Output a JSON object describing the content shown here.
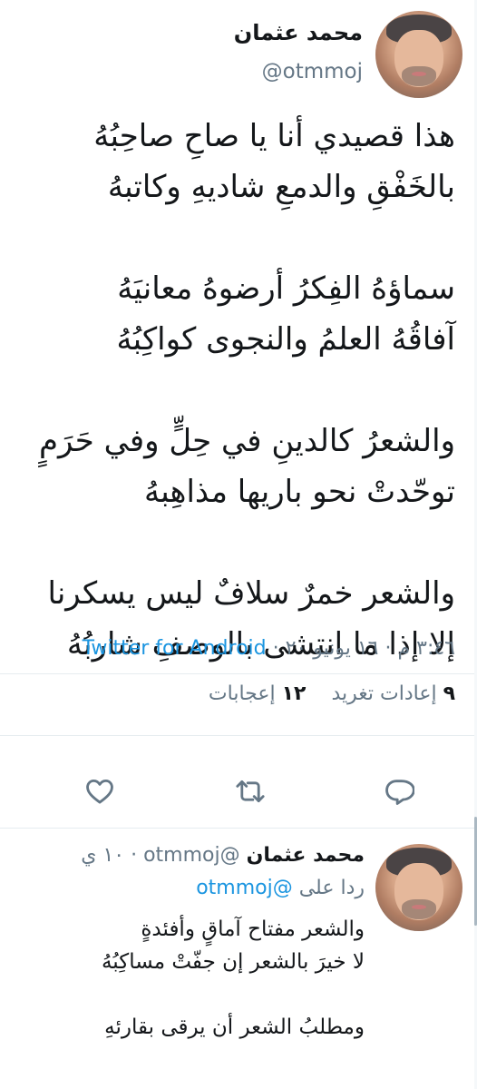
{
  "tweet": {
    "display_name": "محمد عثمان",
    "handle": "@otmmoj",
    "poem_lines": [
      "هذا قصيدي أنا يا صاحِ صاحِبُهُ",
      "بالخَفْقِ والدمعِ شاديهِ وكاتبهُ",
      "",
      "سماؤهُ الفِكرُ أرضوهُ معانيَهُ",
      "آفاقُهُ العلمُ والنجوى كواكِبُهُ",
      "",
      "والشعرُ كالدينِ في حِلٍّ وفي حَرَمٍ",
      "توحّدتْ نحو باريها مذاهِبهُ",
      "",
      "والشعر خمرٌ سلافٌ ليس يسكرنا",
      "إلا إذا ما انتشى بالوصفِ شاربُهُ"
    ],
    "time": "٣:٤٦ م",
    "separator": "·",
    "date": "١٦ يونيو ٢٠",
    "source_app": "Twitter for Android",
    "retweets_count": "٩",
    "retweets_label": "إعادات تغريد",
    "likes_count": "١٢",
    "likes_label": "إعجابات"
  },
  "actions": {
    "reply_icon": "reply-icon",
    "retweet_icon": "retweet-icon",
    "like_icon": "heart-icon"
  },
  "reply": {
    "display_name": "محمد عثمان",
    "handle": "@otmmoj",
    "time_ago": "١٠ ي",
    "replying_prefix": "ردا على",
    "replying_mention": "@otmmoj",
    "lines": [
      "والشعر مفتاح آماقٍ وأفئدةٍ",
      "لا خيرَ بالشعر إن جفّتْ مساكِبُهُ",
      "",
      "ومطلبُ الشعر أن يرقى بقارئهِ"
    ]
  },
  "colors": {
    "text": "#14171a",
    "secondary": "#657786",
    "accent": "#1b95e0",
    "divider": "#e6ecf0"
  }
}
